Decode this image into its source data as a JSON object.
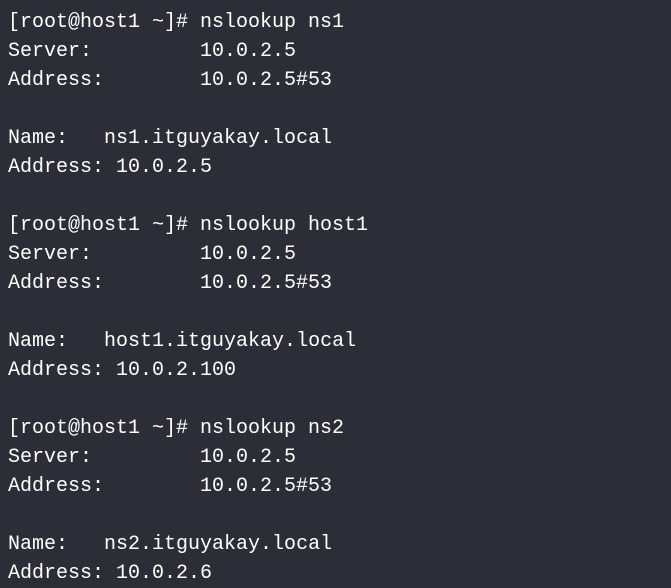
{
  "prompt_prefix": "[root@host1 ~]# ",
  "queries": [
    {
      "command": "nslookup ns1",
      "server_label": "Server:",
      "server_value": "10.0.2.5",
      "address_port_label": "Address:",
      "address_port_value": "10.0.2.5#53",
      "name_label": "Name:",
      "name_value": "ns1.itguyakay.local",
      "result_address_label": "Address: ",
      "result_address_value": "10.0.2.5"
    },
    {
      "command": "nslookup host1",
      "server_label": "Server:",
      "server_value": "10.0.2.5",
      "address_port_label": "Address:",
      "address_port_value": "10.0.2.5#53",
      "name_label": "Name:",
      "name_value": "host1.itguyakay.local",
      "result_address_label": "Address: ",
      "result_address_value": "10.0.2.100"
    },
    {
      "command": "nslookup ns2",
      "server_label": "Server:",
      "server_value": "10.0.2.5",
      "address_port_label": "Address:",
      "address_port_value": "10.0.2.5#53",
      "name_label": "Name:",
      "name_value": "ns2.itguyakay.local",
      "result_address_label": "Address: ",
      "result_address_value": "10.0.2.6"
    }
  ]
}
